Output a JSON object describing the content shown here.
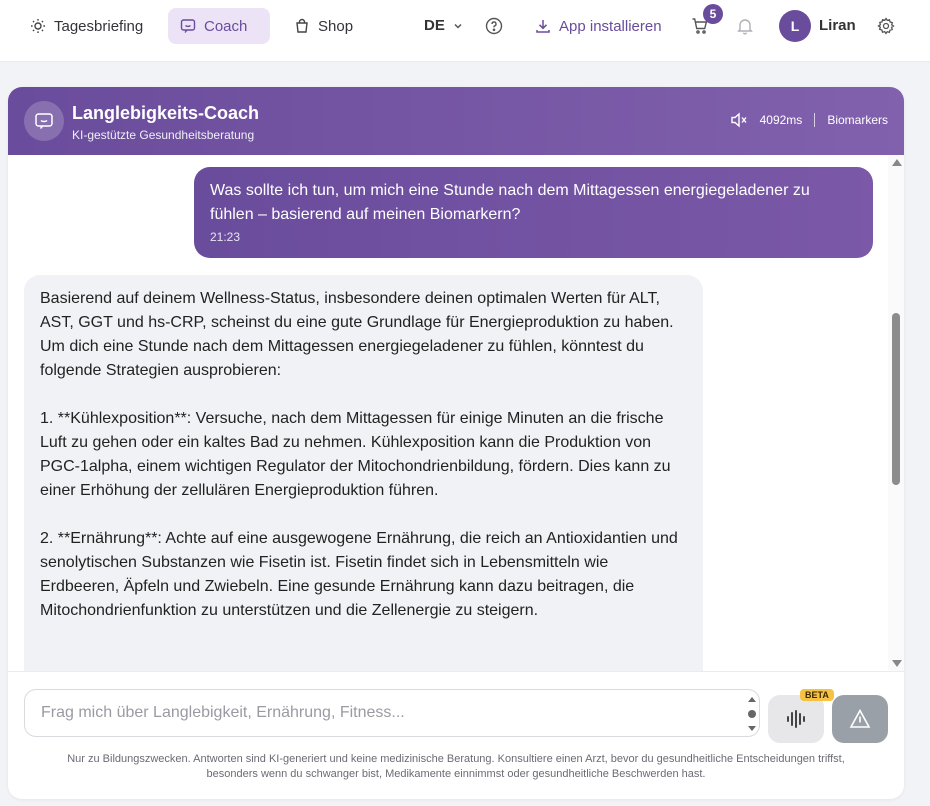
{
  "nav": {
    "briefing": "Tagesbriefing",
    "coach": "Coach",
    "shop": "Shop",
    "language": "DE",
    "install": "App installieren",
    "cart_count": "5",
    "user_initial": "L",
    "user_name": "Liran"
  },
  "coach": {
    "title": "Langlebigkeits-Coach",
    "subtitle": "KI-gestützte Gesundheitsberatung",
    "latency": "4092ms",
    "biomarkers_label": "Biomarkers"
  },
  "messages": {
    "user": {
      "text": "Was sollte ich tun, um mich eine Stunde nach dem Mittagessen energiegeladener zu fühlen – basierend auf meinen Biomarkern?",
      "time": "21:23"
    },
    "bot": {
      "p1": "Basierend auf deinem Wellness-Status, insbesondere deinen optimalen Werten für ALT, AST, GGT und hs-CRP, scheinst du eine gute Grundlage für Energieproduktion zu haben. Um dich eine Stunde nach dem Mittagessen energiegeladener zu fühlen, könntest du folgende Strategien ausprobieren:",
      "p2": "1. **Kühlexposition**: Versuche, nach dem Mittagessen für einige Minuten an die frische Luft zu gehen oder ein kaltes Bad zu nehmen. Kühlexposition kann die Produktion von PGC-1alpha, einem wichtigen Regulator der Mitochondrienbildung, fördern. Dies kann zu einer Erhöhung der zellulären Energieproduktion führen.",
      "p3": "2. **Ernährung**: Achte auf eine ausgewogene Ernährung, die reich an Antioxidantien und senolytischen Substanzen wie Fisetin ist. Fisetin findet sich in Lebensmitteln wie Erdbeeren, Äpfeln und Zwiebeln. Eine gesunde Ernährung kann dazu beitragen, die Mitochondrienfunktion zu unterstützen und die Zellenergie zu steigern."
    }
  },
  "composer": {
    "placeholder": "Frag mich über Langlebigkeit, Ernährung, Fitness...",
    "beta": "BETA",
    "disclaimer": "Nur zu Bildungszwecken. Antworten sind KI-generiert und keine medizinische Beratung. Konsultiere einen Arzt, bevor du gesundheitliche Entscheidungen triffst, besonders wenn du schwanger bist, Medikamente einnimmst oder gesundheitliche Beschwerden hast."
  },
  "colors": {
    "accent": "#6a4c9c",
    "accent_light": "#ece3f7",
    "beta_bg": "#f6c244"
  },
  "icons": [
    "sun-icon",
    "chat-icon",
    "bag-icon",
    "chevron-down-icon",
    "help-icon",
    "download-icon",
    "cart-icon",
    "bell-icon",
    "gear-icon",
    "mute-icon",
    "waveform-icon",
    "send-icon"
  ]
}
